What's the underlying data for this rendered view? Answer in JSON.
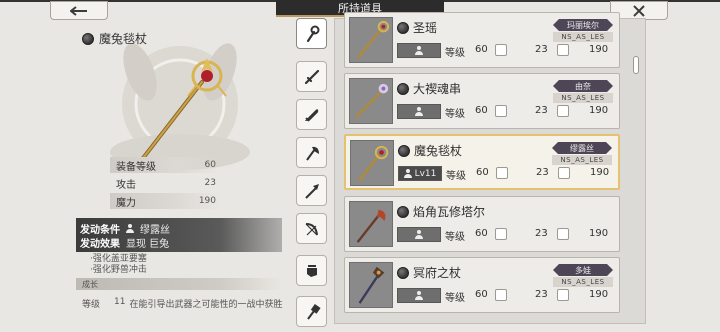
{
  "header": {
    "title": "所持道具",
    "back_icon": "arrow-left-icon",
    "close_icon": "close-icon"
  },
  "detail": {
    "name": "魔兔毯杖",
    "stats": [
      {
        "label": "装备等级",
        "value": "60"
      },
      {
        "label": "攻击",
        "value": "23"
      },
      {
        "label": "魔力",
        "value": "190"
      }
    ],
    "skill": {
      "condition_label": "发动条件",
      "condition_value": "缪露丝",
      "effect_label": "发动效果",
      "effect_value": "显现 巨兔"
    },
    "bullets": [
      "·强化盖亚要塞",
      "·强化野兽冲击"
    ],
    "growth_title": "成长",
    "growth_label": "等级",
    "growth_level": "11",
    "growth_desc": "在能引导出武器之可能性的一战中获胜"
  },
  "tabs": [
    {
      "icon": "staff-icon",
      "active": true
    },
    {
      "icon": "sword-icon",
      "active": false
    },
    {
      "icon": "dagger-icon",
      "active": false
    },
    {
      "icon": "axe-icon",
      "active": false
    },
    {
      "icon": "spear-icon",
      "active": false
    },
    {
      "icon": "bow-icon",
      "active": false
    },
    {
      "icon": "gauntlet-icon",
      "active": false
    },
    {
      "icon": "hammer-icon",
      "active": false
    }
  ],
  "list": {
    "level_label": "等级",
    "items": [
      {
        "name": "圣瑶",
        "owner": "玛丽埃尔",
        "class_tag": "NS_AS_LES",
        "equipped": "",
        "level": "60",
        "attack": "23",
        "magic": "190",
        "selected": false
      },
      {
        "name": "大禊魂串",
        "owner": "由奈",
        "class_tag": "NS_AS_LES",
        "equipped": "",
        "level": "60",
        "attack": "23",
        "magic": "190",
        "selected": false
      },
      {
        "name": "魔兔毯杖",
        "owner": "缪露丝",
        "class_tag": "NS_AS_LES",
        "equipped": "Lv11",
        "level": "60",
        "attack": "23",
        "magic": "190",
        "selected": true
      },
      {
        "name": "焰角瓦修塔尔",
        "owner": "",
        "class_tag": "",
        "equipped": "",
        "level": "60",
        "attack": "23",
        "magic": "190",
        "selected": false
      },
      {
        "name": "冥府之杖",
        "owner": "多娃",
        "class_tag": "NS_AS_LES",
        "equipped": "",
        "level": "60",
        "attack": "23",
        "magic": "190",
        "selected": false
      }
    ]
  },
  "colors": {
    "selected_border": "#e4c272",
    "owner_tag_bg": "#4e4556",
    "header_bg": "#2c2c2c"
  }
}
